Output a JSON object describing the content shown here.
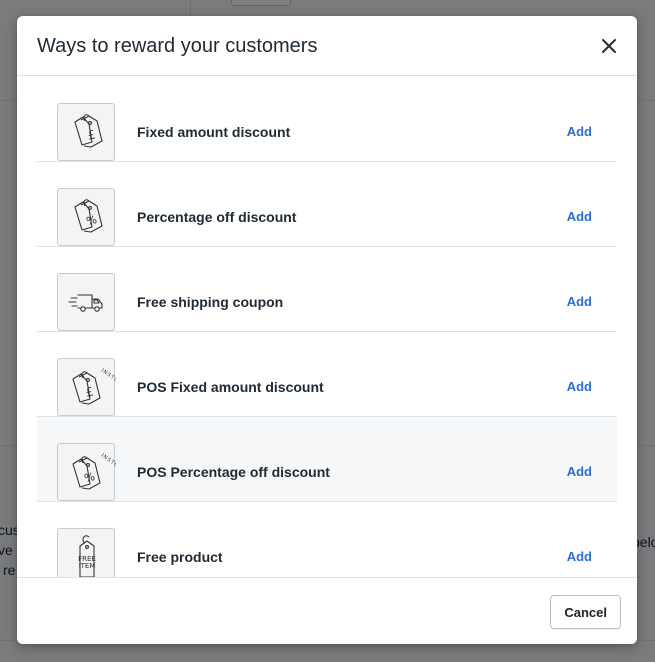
{
  "modal": {
    "title": "Ways to reward your customers",
    "close_icon": "close-icon",
    "items": [
      {
        "label": "Fixed amount discount",
        "action": "Add",
        "icon": "pound-tag-icon"
      },
      {
        "label": "Percentage off discount",
        "action": "Add",
        "icon": "percent-tag-icon"
      },
      {
        "label": "Free shipping coupon",
        "action": "Add",
        "icon": "delivery-truck-icon"
      },
      {
        "label": "POS Fixed amount discount",
        "action": "Add",
        "icon": "instore-pound-tag-icon"
      },
      {
        "label": "POS Percentage off discount",
        "action": "Add",
        "icon": "instore-percent-tag-icon"
      },
      {
        "label": "Free product",
        "action": "Add",
        "icon": "free-item-tag-icon"
      }
    ],
    "cancel_label": "Cancel"
  },
  "background": {
    "left_text": [
      "cus",
      "ve",
      "re"
    ],
    "right_text": "belo"
  },
  "colors": {
    "link": "#2c6ecb",
    "text": "#212b36",
    "border": "#dfe3e8"
  },
  "thumb_text": {
    "pound": "£",
    "percent": "%",
    "instore": "INSTORE",
    "free_item": [
      "FREE",
      "ITEM"
    ]
  }
}
